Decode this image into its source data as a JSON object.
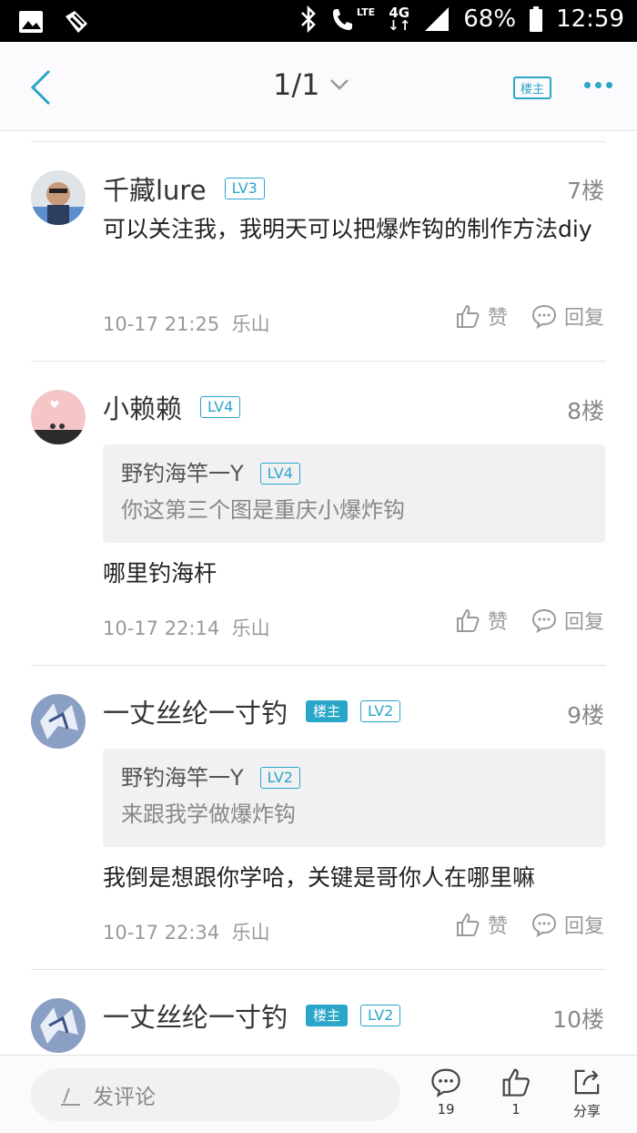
{
  "status": {
    "battery": "68%",
    "time": "12:59",
    "lte": "LTE",
    "network": "4G"
  },
  "header": {
    "page_indicator": "1/1",
    "louzhu_filter": "楼主"
  },
  "comments": [
    {
      "user": "千藏lure",
      "level": "LV3",
      "floor": "7楼",
      "text": "可以关注我，我明天可以把爆炸钩的制作方法diy",
      "time": "10-17 21:25",
      "location": "乐山"
    },
    {
      "user": "小赖赖",
      "level": "LV4",
      "floor": "8楼",
      "quote_user": "野钓海竿一Y",
      "quote_level": "LV4",
      "quote_text": "你这第三个图是重庆小爆炸钩",
      "text": "哪里钓海杆",
      "time": "10-17 22:14",
      "location": "乐山"
    },
    {
      "user": "一丈丝纶一寸钓",
      "badge": "楼主",
      "level": "LV2",
      "floor": "9楼",
      "quote_user": "野钓海竿一Y",
      "quote_level": "LV2",
      "quote_text": "来跟我学做爆炸钩",
      "text": "我倒是想跟你学哈，关键是哥你人在哪里嘛",
      "time": "10-17 22:34",
      "location": "乐山"
    },
    {
      "user": "一丈丝纶一寸钓",
      "badge": "楼主",
      "level": "LV2",
      "floor": "10楼"
    }
  ],
  "actions": {
    "like": "赞",
    "reply": "回复"
  },
  "bottom": {
    "placeholder": "发评论",
    "comment_count": "19",
    "like_count": "1",
    "share": "分享"
  },
  "colors": {
    "accent": "#2aa6c8"
  }
}
